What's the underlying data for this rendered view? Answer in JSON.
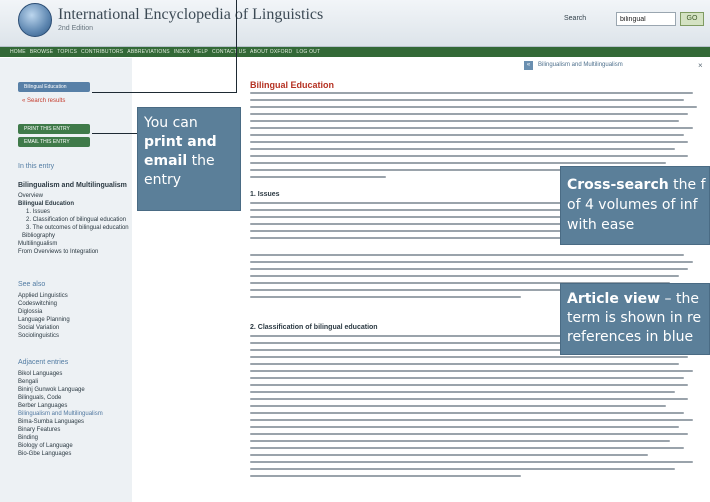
{
  "header": {
    "title": "International Encyclopedia of Linguistics",
    "subtitle": "2nd Edition",
    "search_label": "Search",
    "search_value": "bilingual",
    "go_label": "GO"
  },
  "navbar": {
    "items": [
      "HOME",
      "BROWSE",
      "TOPICS",
      "CONTRIBUTORS",
      "ABBREVIATIONS",
      "INDEX",
      "HELP",
      "CONTACT US",
      "ABOUT OXFORD",
      "LOG OUT"
    ]
  },
  "breadcrumb": {
    "text": "Bilingualism and Multilingualism"
  },
  "sidebar": {
    "back_button": "Bilingual Education",
    "search_results": "« Search results",
    "print_button": "PRINT THIS ENTRY",
    "email_button": "EMAIL THIS ENTRY",
    "in_this_entry": "In this entry",
    "entry_items": [
      "Bilingualism and Multilingualism",
      "Overview",
      "Bilingual Education",
      "1. Issues",
      "2. Classification of bilingual education",
      "3. The outcomes of bilingual education",
      "Bibliography",
      "Multilingualism",
      "From Overviews to Integration"
    ],
    "see_also_heading": "See also",
    "see_also_items": [
      "Applied Linguistics",
      "Codeswitching",
      "Diglossia",
      "Language Planning",
      "Social Variation",
      "Sociolinguistics"
    ],
    "adjacent_heading": "Adjacent entries",
    "adjacent_items": [
      "Bikol Languages",
      "Bengali",
      "Bininj Gunwok Language",
      "Bilinguals, Code",
      "Berber Languages",
      "Bilingualism and Multilingualism",
      "Bima-Sumba Languages",
      "Binary Features",
      "Binding",
      "Biology of Language",
      "Bio-Gbe Languages"
    ]
  },
  "article": {
    "title": "Bilingual Education",
    "sections": [
      "1. Issues",
      "2. Classification of bilingual education"
    ]
  },
  "callouts": {
    "print": {
      "line1_plain": "You can",
      "line2_bold": "print and",
      "line3_bold": "email",
      "line3_plain": " the",
      "line4_plain": "entry"
    },
    "cross": {
      "bold": "Cross-search",
      "line1_rest": " the f",
      "line2": "of 4 volumes of inf",
      "line3": "with ease"
    },
    "article": {
      "bold": "Article view",
      "line1_rest": " – the",
      "line2": "term is shown in re",
      "line3": "references in blue"
    }
  },
  "colors": {
    "nav_green": "#336937",
    "callout_blue": "#5b7f99",
    "title_red": "#b53122",
    "link_blue": "#527ca3"
  }
}
